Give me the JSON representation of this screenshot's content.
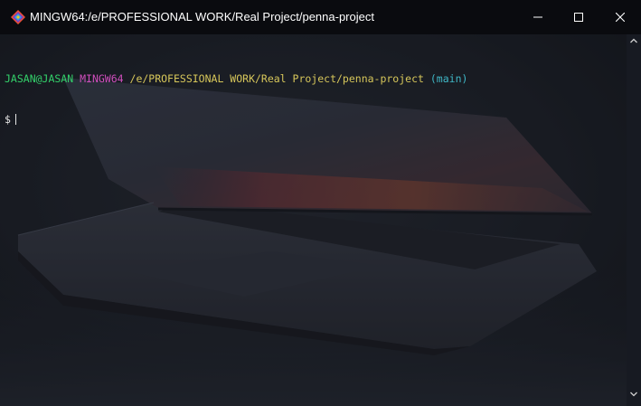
{
  "window": {
    "title": "MINGW64:/e/PROFESSIONAL WORK/Real Project/penna-project",
    "app_icon": "git-bash-icon",
    "controls": {
      "minimize_icon": "minimize-icon",
      "maximize_icon": "maximize-icon",
      "close_icon": "close-icon"
    }
  },
  "terminal": {
    "prompt": {
      "user_host": "JASAN@JASAN",
      "system": "MINGW64",
      "path": "/e/PROFESSIONAL WORK/Real Project/penna-project",
      "branch": "(main)",
      "symbol": "$"
    },
    "input": ""
  },
  "colors": {
    "titlebar": "#0a0b0f",
    "user_host": "#33d16a",
    "system": "#d14fbe",
    "path": "#d6c65a",
    "branch": "#3fb7c6"
  }
}
